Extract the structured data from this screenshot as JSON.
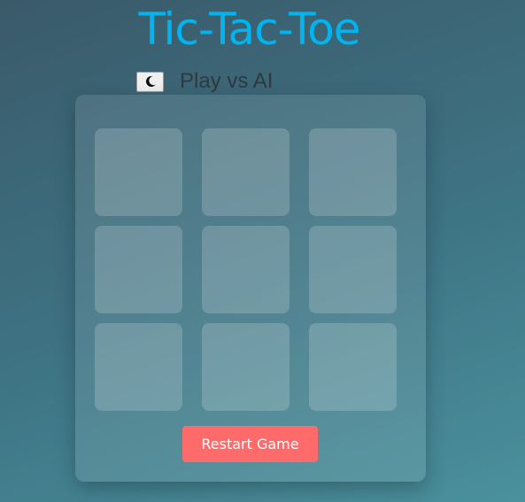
{
  "game": {
    "title": "Tic-Tac-Toe",
    "mode_label": "Play vs AI",
    "theme_toggle_icon": "moon-icon",
    "restart_label": "Restart Game"
  },
  "board": {
    "cells": [
      "",
      "",
      "",
      "",
      "",
      "",
      "",
      "",
      ""
    ]
  },
  "colors": {
    "title": "#00b4f0",
    "restart_button": "#ff6b6b"
  }
}
